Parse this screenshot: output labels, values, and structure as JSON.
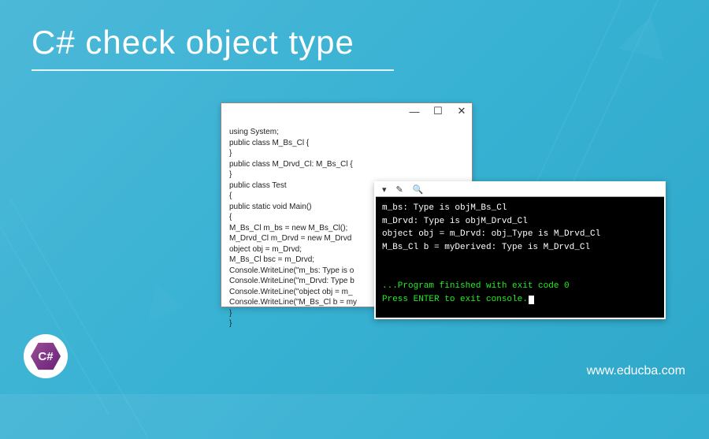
{
  "title": "C# check object type",
  "editor": {
    "code": "using System;\npublic class M_Bs_Cl {\n}\npublic class M_Drvd_Cl: M_Bs_Cl {\n}\npublic class Test\n{\npublic static void Main()\n{\nM_Bs_Cl m_bs = new M_Bs_Cl();\nM_Drvd_Cl m_Drvd = new M_Drvd\nobject obj = m_Drvd;\nM_Bs_Cl bsc = m_Drvd;\nConsole.WriteLine(\"m_bs: Type is o\nConsole.WriteLine(\"m_Drvd: Type b\nConsole.WriteLine(\"object obj = m_\nConsole.WriteLine(\"M_Bs_Cl b = my\n}\n}"
  },
  "console": {
    "lines": [
      "m_bs: Type is objM_Bs_Cl",
      "m_Drvd: Type is objM_Drvd_Cl",
      "object obj = m_Drvd: obj_Type is M_Drvd_Cl",
      "M_Bs_Cl b = myDerived: Type is M_Drvd_Cl"
    ],
    "exit": "...Program finished with exit code 0",
    "prompt": "Press ENTER to exit console."
  },
  "logo_text": "C#",
  "url": "www.educba.com",
  "win": {
    "min": "—",
    "max": "☐",
    "close": "✕"
  }
}
